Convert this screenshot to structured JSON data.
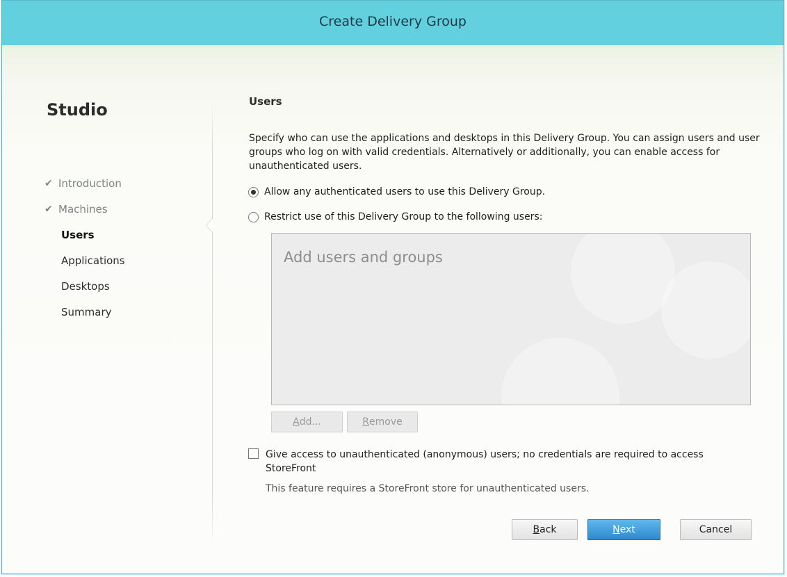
{
  "window": {
    "title": "Create Delivery Group"
  },
  "nav": {
    "brand": "Studio",
    "items": [
      {
        "label": "Introduction",
        "state": "done"
      },
      {
        "label": "Machines",
        "state": "done"
      },
      {
        "label": "Users",
        "state": "current"
      },
      {
        "label": "Applications",
        "state": "pending"
      },
      {
        "label": "Desktops",
        "state": "pending"
      },
      {
        "label": "Summary",
        "state": "pending"
      }
    ],
    "check_icon": "checkmark-icon"
  },
  "main": {
    "section_title": "Users",
    "description": "Specify who can use the applications and desktops in this Delivery Group. You can assign users and user groups who log on with valid credentials. Alternatively or additionally, you can enable access for unauthenticated users.",
    "radio_allow": {
      "label": "Allow any authenticated users to use this Delivery Group.",
      "selected": true
    },
    "radio_restrict": {
      "label": "Restrict use of this Delivery Group to the following users:",
      "selected": false
    },
    "users_box_placeholder": "Add users and groups",
    "add_button": {
      "label_underlined": "A",
      "label_rest": "dd...",
      "enabled": false
    },
    "remove_button": {
      "label_underlined": "R",
      "label_rest": "emove",
      "enabled": false
    },
    "anonymous_checkbox": {
      "label": "Give access to unauthenticated (anonymous) users; no credentials are required to access StoreFront",
      "checked": false
    },
    "anonymous_note": "This feature requires a StoreFront store for unauthenticated users."
  },
  "footer": {
    "back": {
      "label_underlined": "B",
      "label_rest": "ack"
    },
    "next": {
      "label_underlined": "N",
      "label_rest": "ext"
    },
    "cancel": {
      "label": "Cancel"
    }
  },
  "colors": {
    "titlebar": "#63d0e0",
    "primary_button": "#2f88cf"
  }
}
